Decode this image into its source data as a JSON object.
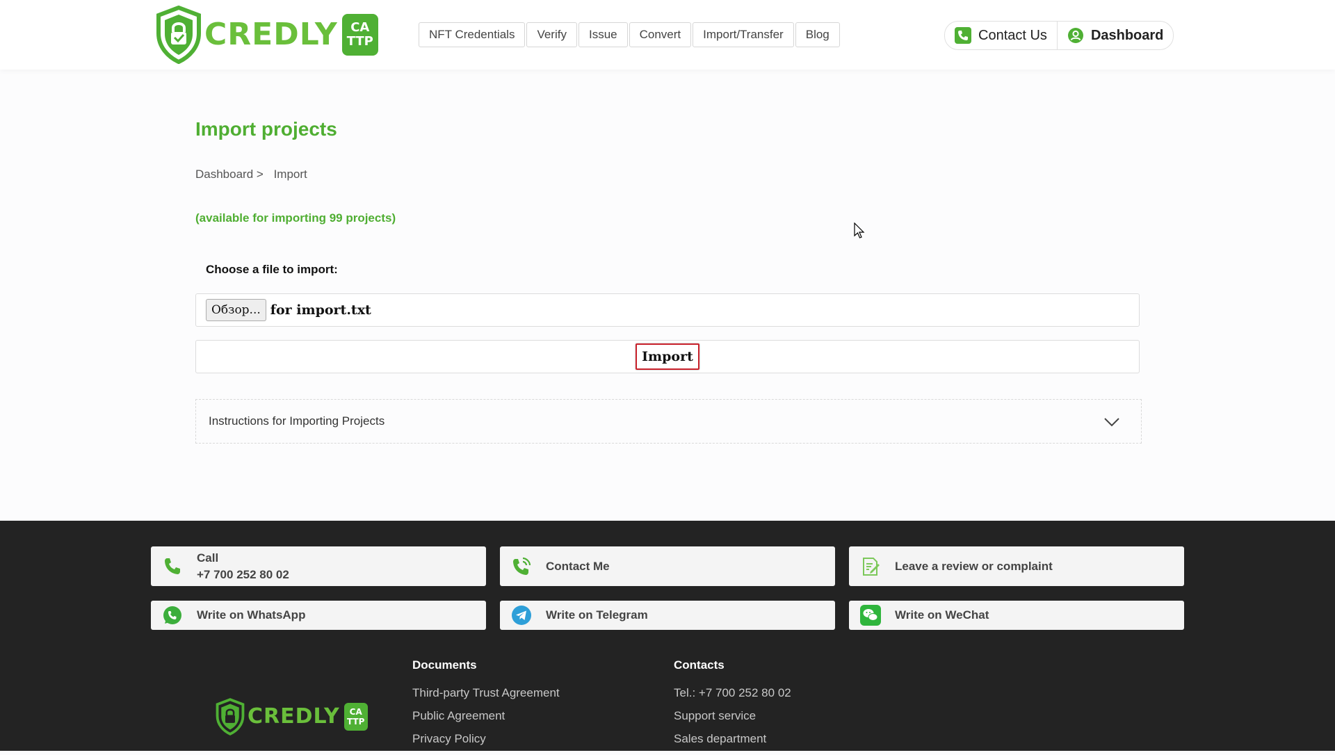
{
  "header": {
    "logo": {
      "text": "CREDLY",
      "badge_line1": "CA",
      "badge_line2": "TTP"
    },
    "nav": [
      "NFT Credentials",
      "Verify",
      "Issue",
      "Convert",
      "Import/Transfer",
      "Blog"
    ],
    "contact_label": "Contact Us",
    "dashboard_label": "Dashboard"
  },
  "main": {
    "title": "Import projects",
    "breadcrumb": {
      "parent": "Dashboard >",
      "current": "Import"
    },
    "availability": "(available for importing 99 projects)",
    "choose_label": "Choose a file to import:",
    "browse_label": "Обзор...",
    "file_name": "for import.txt",
    "import_label": "Import",
    "instructions_label": "Instructions for Importing Projects"
  },
  "footer": {
    "call": {
      "label": "Call",
      "phone": "+7 700 252 80 02"
    },
    "contact_me": "Contact Me",
    "review": "Leave a review or complaint",
    "whatsapp": "Write on WhatsApp",
    "telegram": "Write on Telegram",
    "wechat": "Write on WeChat",
    "documents": {
      "heading": "Documents",
      "links": [
        "Third-party Trust Agreement",
        "Public Agreement",
        "Privacy Policy"
      ]
    },
    "contacts": {
      "heading": "Contacts",
      "links": [
        "Tel.: +7 700 252 80 02",
        "Support service",
        "Sales department"
      ]
    }
  },
  "colors": {
    "brand_green": "#4fae32",
    "footer_bg": "#232323",
    "import_border": "#c8212b"
  },
  "icons": [
    "shield-check-icon",
    "phone-icon",
    "user-icon",
    "chevron-down-icon",
    "whatsapp-icon",
    "telegram-icon",
    "wechat-icon",
    "review-icon",
    "mouse-cursor-icon"
  ]
}
